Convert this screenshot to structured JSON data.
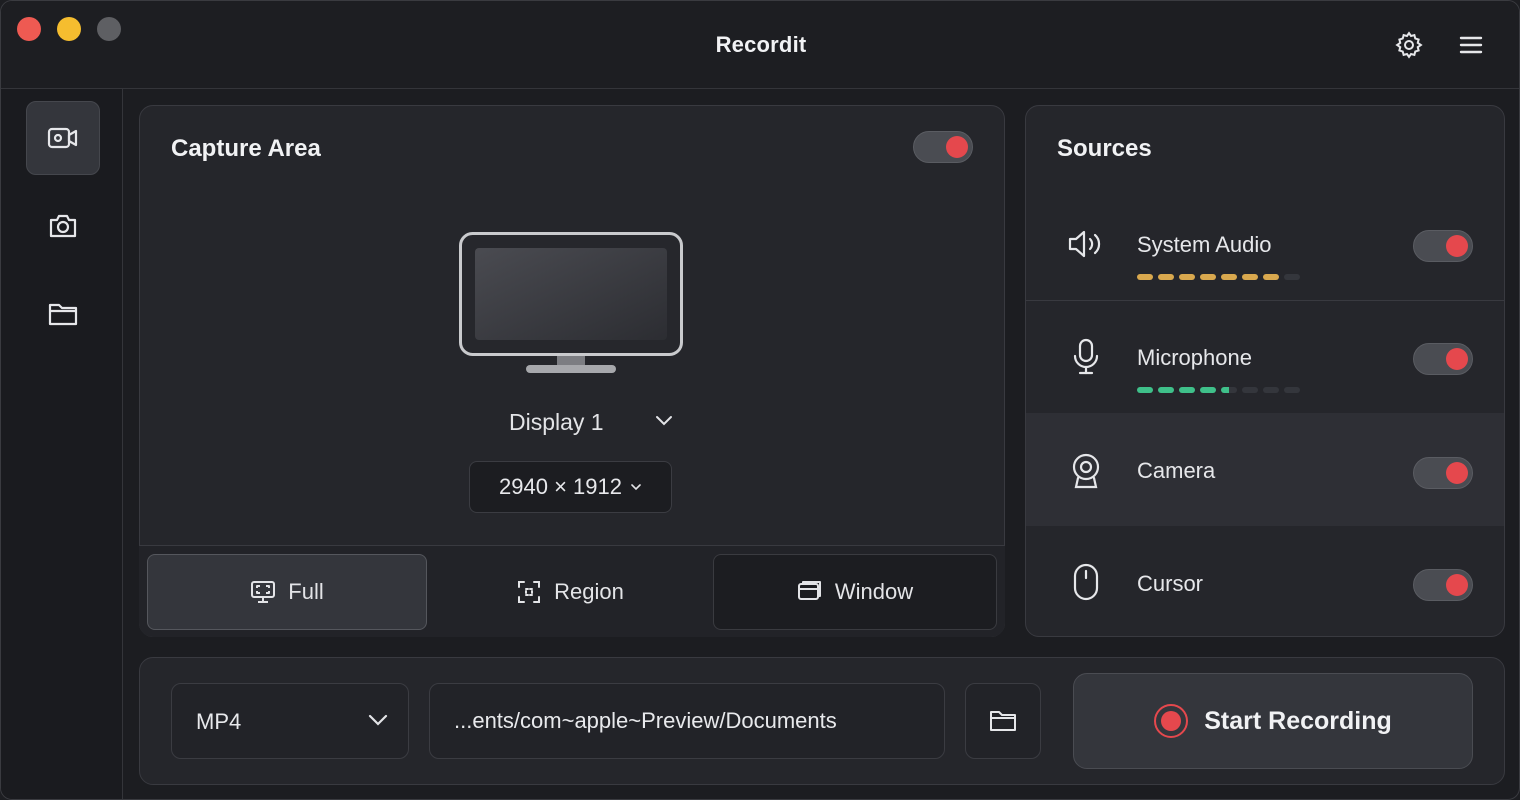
{
  "app": {
    "title": "Recordit"
  },
  "titlebar": {
    "settings_icon": "gear-icon",
    "menu_icon": "hamburger-menu-icon"
  },
  "sidebar": {
    "items": [
      {
        "icon": "video-camera-icon",
        "active": true
      },
      {
        "icon": "camera-icon",
        "active": false
      },
      {
        "icon": "folder-icon",
        "active": false
      }
    ]
  },
  "capture": {
    "title": "Capture Area",
    "enabled": true,
    "display_label": "Display 1",
    "resolution": "2940 × 1912",
    "modes": [
      {
        "label": "Full",
        "icon": "fullscreen-monitor-icon",
        "active": true
      },
      {
        "label": "Region",
        "icon": "region-select-icon",
        "active": false
      },
      {
        "label": "Window",
        "icon": "window-icon",
        "active": false
      }
    ]
  },
  "sources": {
    "title": "Sources",
    "items": [
      {
        "label": "System Audio",
        "icon": "speaker-icon",
        "enabled": true,
        "level_segments_active": 7,
        "level_segments_total": 8,
        "meter_color": "#d9a84e"
      },
      {
        "label": "Microphone",
        "icon": "microphone-icon",
        "enabled": true,
        "level_segments_active": 4.5,
        "level_segments_total": 8,
        "meter_color": "#3fc08a"
      },
      {
        "label": "Camera",
        "icon": "webcam-icon",
        "enabled": true,
        "highlighted": true
      },
      {
        "label": "Cursor",
        "icon": "mouse-icon",
        "enabled": true
      }
    ]
  },
  "output": {
    "format": "MP4",
    "path": "...ents/com~apple~Preview/Documents",
    "record_label": "Start Recording"
  },
  "colors": {
    "accent_red": "#e5484d",
    "background": "#1c1d21",
    "panel": "#25262b"
  }
}
